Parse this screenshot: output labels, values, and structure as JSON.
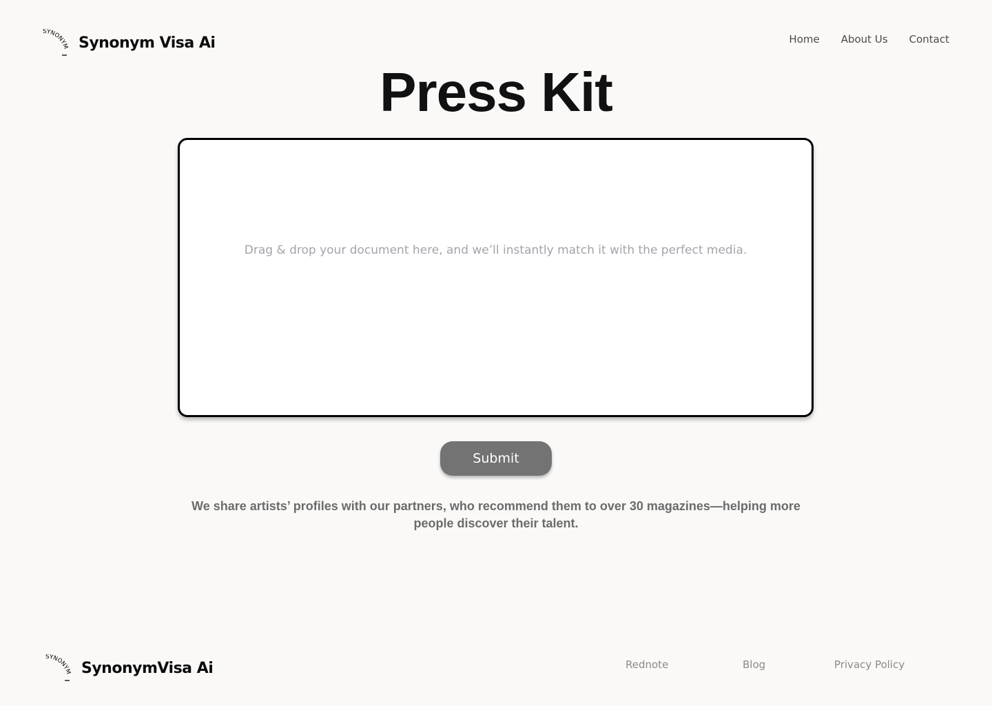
{
  "header": {
    "brand": "Synonym Visa Ai",
    "logo_text": "SYNONYM",
    "nav": [
      "Home",
      "About Us",
      "Contact"
    ]
  },
  "main": {
    "title": "Press Kit",
    "dropzone_text": "Drag & drop your document here, and we’ll instantly match it with the perfect media.",
    "submit_label": "Submit",
    "description": "We share artists’ profiles with our partners, who recommend them to over 30 magazines—helping more people discover their talent."
  },
  "footer": {
    "brand": "SynonymVisa Ai",
    "logo_text": "SYNONYM",
    "links": [
      "Rednote",
      "Blog",
      "Privacy Policy"
    ]
  },
  "colors": {
    "background": "#faf9f7",
    "button": "#737373",
    "placeholder": "#a3a3ab"
  },
  "icons": {
    "logo": "circular-text-logo-icon"
  }
}
